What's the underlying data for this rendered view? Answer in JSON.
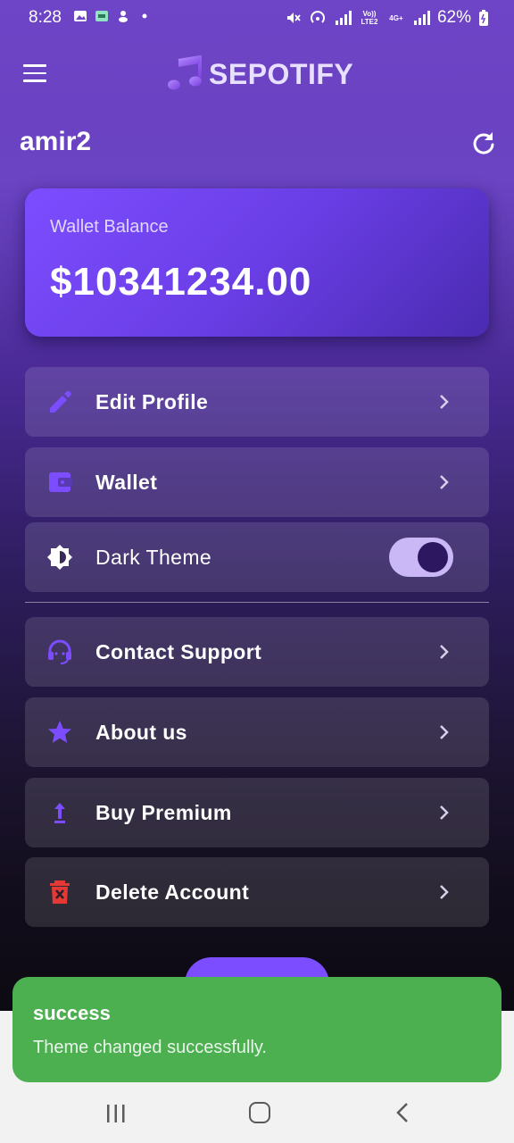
{
  "status_bar": {
    "time": "8:28",
    "battery": "62%",
    "network_small_1": "Vo)) LTE2",
    "network_small_2": "4G+"
  },
  "app_bar": {
    "menu_icon": "hamburger-menu-icon",
    "logo_icon": "music-note-icon",
    "title": "SEPOTIFY"
  },
  "user": {
    "username": "amir2",
    "refresh_icon": "refresh-icon"
  },
  "wallet_card": {
    "label": "Wallet Balance",
    "amount": "$10341234.00"
  },
  "menu": {
    "edit_profile": {
      "label": "Edit Profile",
      "icon": "pencil-icon"
    },
    "wallet": {
      "label": "Wallet",
      "icon": "wallet-icon"
    },
    "dark_theme": {
      "label": "Dark Theme",
      "icon": "brightness-icon",
      "toggle_on": true
    },
    "contact_support": {
      "label": "Contact Support",
      "icon": "headset-icon"
    },
    "about_us": {
      "label": "About us",
      "icon": "star-icon"
    },
    "buy_premium": {
      "label": "Buy Premium",
      "icon": "upload-arrow-icon"
    },
    "delete_account": {
      "label": "Delete Account",
      "icon": "delete-icon"
    }
  },
  "snackbar": {
    "title": "success",
    "message": "Theme changed successfully."
  },
  "colors": {
    "accent": "#7c4dff",
    "snackbar_bg": "#4caf50",
    "delete_red": "#e53935"
  }
}
